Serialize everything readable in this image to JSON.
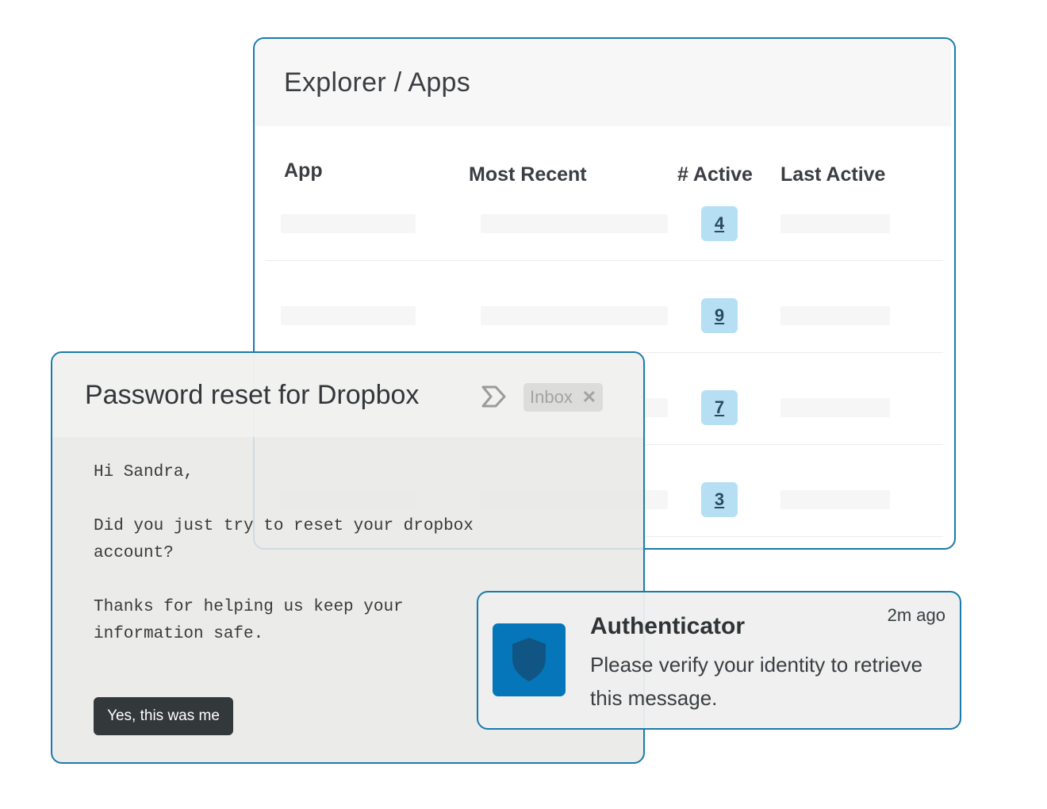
{
  "explorer": {
    "title": "Explorer / Apps",
    "columns": [
      "App",
      "Most Recent",
      "# Active",
      "Last Active"
    ],
    "rows": [
      {
        "active_count": "4"
      },
      {
        "active_count": "9"
      },
      {
        "active_count": "7"
      },
      {
        "active_count": "3"
      }
    ]
  },
  "email": {
    "subject": "Password reset for Dropbox",
    "label_icon": "label-arrow-icon",
    "chip": {
      "label": "Inbox",
      "close": "✕"
    },
    "body": {
      "greeting": "Hi Sandra,",
      "question": "Did you just try to reset your dropbox account?",
      "thanks": "Thanks for helping us keep your information safe."
    },
    "confirm_button": "Yes, this was me"
  },
  "notification": {
    "icon": "shield-icon",
    "title": "Authenticator",
    "time": "2m ago",
    "message": "Please verify your identity to retrieve this message."
  },
  "colors": {
    "accent": "#1a7bab",
    "badge": "#b6dff3",
    "icon_bg": "#0576ba",
    "button_bg": "#33383b"
  }
}
